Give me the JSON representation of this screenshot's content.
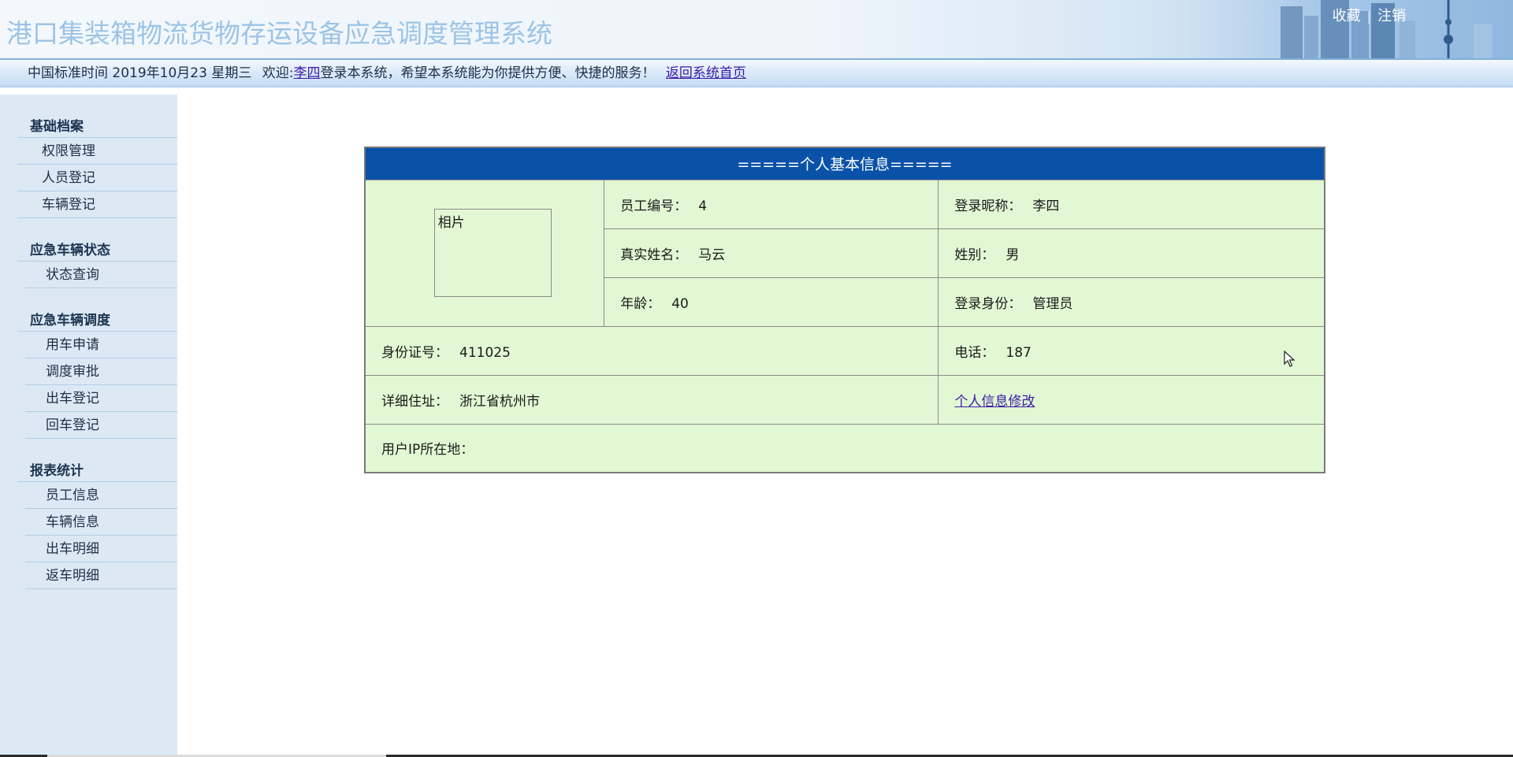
{
  "header": {
    "title": "港口集装箱物流货物存运设备应急调度管理系统",
    "links": {
      "favorite": "收藏",
      "separator": "|",
      "logout": "注销"
    }
  },
  "infobar": {
    "time_text": "中国标准时间 2019年10月23 星期三",
    "welcome_prefix": "欢迎:",
    "username": "李四",
    "welcome_suffix": "登录本系统，希望本系统能为你提供方便、快捷的服务！",
    "home_link": "返回系统首页"
  },
  "sidebar": {
    "groups": [
      {
        "title": "基础档案",
        "items": [
          "权限管理",
          "人员登记",
          "车辆登记"
        ]
      },
      {
        "title": "应急车辆状态",
        "items": [
          "状态查询"
        ]
      },
      {
        "title": "应急车辆调度",
        "items": [
          "用车申请",
          "调度审批",
          "出车登记",
          "回车登记"
        ]
      },
      {
        "title": "报表统计",
        "items": [
          "员工信息",
          "车辆信息",
          "出车明细",
          "返车明细"
        ]
      }
    ]
  },
  "profile": {
    "caption": "=====个人基本信息=====",
    "photo_label": "相片",
    "employee_no": {
      "label": "员工编号：",
      "value": "4"
    },
    "nickname": {
      "label": "登录昵称：",
      "value": "李四"
    },
    "real_name": {
      "label": "真实姓名：",
      "value": "马云"
    },
    "gender": {
      "label": "姓别：",
      "value": "男"
    },
    "age": {
      "label": "年龄：",
      "value": "40"
    },
    "role": {
      "label": "登录身份：",
      "value": "管理员"
    },
    "id_card": {
      "label": "身份证号：",
      "value": "411025"
    },
    "phone": {
      "label": "电话：",
      "value": "187"
    },
    "address": {
      "label": "详细住址：",
      "value": "浙江省杭州市"
    },
    "edit_link": "个人信息修改",
    "ip_location": {
      "label": "用户IP所在地：",
      "value": ""
    }
  },
  "colors": {
    "caption_bg": "#0a52a8",
    "table_bg": "#e2f8d4",
    "sidebar_bg": "#dce9f5",
    "link": "#3e1aa6"
  }
}
